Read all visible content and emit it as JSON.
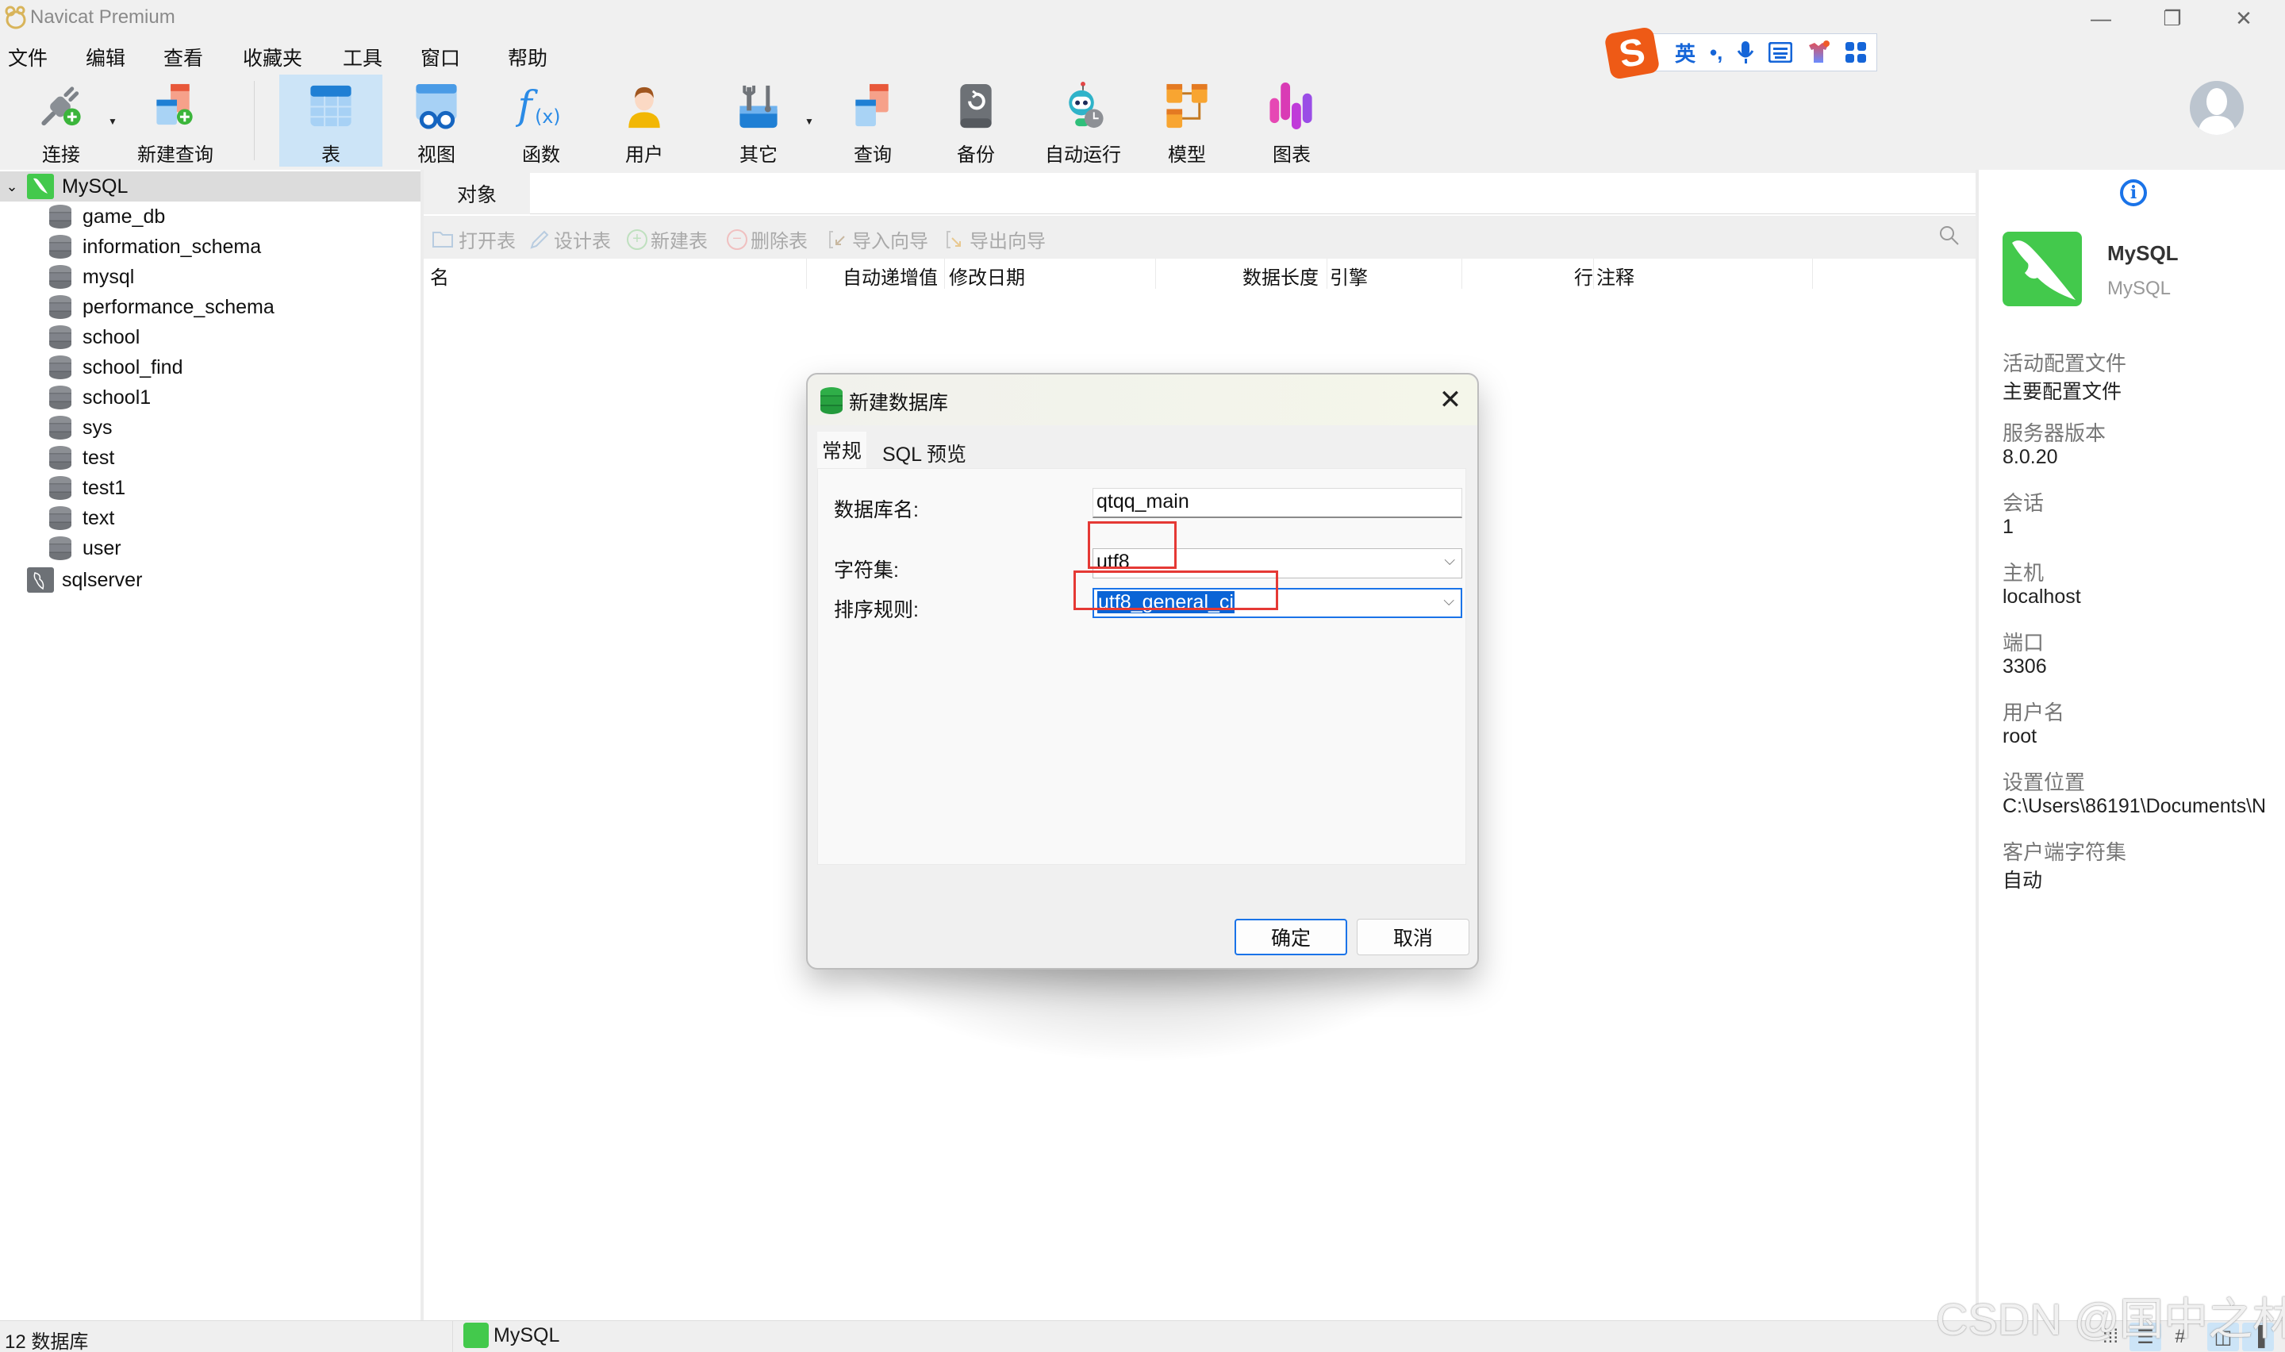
{
  "window": {
    "title": "Navicat Premium",
    "controls": {
      "minimize": "—",
      "restore": "❐",
      "close": "✕"
    }
  },
  "menu": [
    "文件",
    "编辑",
    "查看",
    "收藏夹",
    "工具",
    "窗口",
    "帮助"
  ],
  "toolbar": {
    "items": [
      {
        "label": "连接",
        "icon": "plug-add-icon",
        "has_dropdown": true
      },
      {
        "label": "新建查询",
        "icon": "new-query-icon"
      },
      {
        "label": "表",
        "icon": "table-icon",
        "active": true
      },
      {
        "label": "视图",
        "icon": "view-icon"
      },
      {
        "label": "函数",
        "icon": "function-icon",
        "glyph": "f(x)"
      },
      {
        "label": "用户",
        "icon": "user-icon"
      },
      {
        "label": "其它",
        "icon": "tools-icon",
        "has_dropdown": true
      },
      {
        "label": "查询",
        "icon": "query-icon"
      },
      {
        "label": "备份",
        "icon": "backup-icon"
      },
      {
        "label": "自动运行",
        "icon": "robot-icon"
      },
      {
        "label": "模型",
        "icon": "model-icon"
      },
      {
        "label": "图表",
        "icon": "chart-icon"
      }
    ]
  },
  "ime": {
    "logo": "S",
    "mode": "英",
    "punct": "•,",
    "icons": [
      "mic-icon",
      "keyboard-icon",
      "skin-icon",
      "apps-icon"
    ]
  },
  "sidebar": {
    "connections": [
      {
        "name": "MySQL",
        "expanded": true,
        "selected": true,
        "databases": [
          "game_db",
          "information_schema",
          "mysql",
          "performance_schema",
          "school",
          "school_find",
          "school1",
          "sys",
          "test",
          "test1",
          "text",
          "user"
        ]
      },
      {
        "name": "sqlserver",
        "expanded": false
      }
    ]
  },
  "main": {
    "tab": "对象",
    "object_toolbar": [
      {
        "label": "打开表",
        "icon": "folder-open-icon"
      },
      {
        "label": "设计表",
        "icon": "pencil-icon"
      },
      {
        "label": "新建表",
        "icon": "plus-circle-icon"
      },
      {
        "label": "删除表",
        "icon": "minus-circle-icon"
      },
      {
        "label": "导入向导",
        "icon": "import-icon"
      },
      {
        "label": "导出向导",
        "icon": "export-icon"
      }
    ],
    "columns": [
      "名",
      "自动递增值",
      "修改日期",
      "数据长度",
      "引擎",
      "行",
      "注释"
    ]
  },
  "dialog": {
    "title": "新建数据库",
    "tabs": [
      "常规",
      "SQL 预览"
    ],
    "active_tab": "常规",
    "fields": {
      "db_name_label": "数据库名:",
      "db_name_value": "qtqq_main",
      "charset_label": "字符集:",
      "charset_value": "utf8",
      "collation_label": "排序规则:",
      "collation_value": "utf8_general_ci"
    },
    "ok_label": "确定",
    "cancel_label": "取消",
    "highlight_color": "#e53935"
  },
  "info_panel": {
    "name": "MySQL",
    "type": "MySQL",
    "items": [
      {
        "label": "活动配置文件",
        "value": "主要配置文件"
      },
      {
        "label": "服务器版本",
        "value": "8.0.20"
      },
      {
        "label": "会话",
        "value": "1"
      },
      {
        "label": "主机",
        "value": "localhost"
      },
      {
        "label": "端口",
        "value": "3306"
      },
      {
        "label": "用户名",
        "value": "root"
      },
      {
        "label": "设置位置",
        "value": "C:\\Users\\86191\\Documents\\N"
      },
      {
        "label": "客户端字符集",
        "value": "自动"
      }
    ]
  },
  "statusbar": {
    "count_text": "12 数据库",
    "connection": "MySQL"
  },
  "watermark": "CSDN @国中之林",
  "colors": {
    "accent": "#1a73e8",
    "mysql_green": "#43c94c",
    "selection": "#cce4f7"
  }
}
